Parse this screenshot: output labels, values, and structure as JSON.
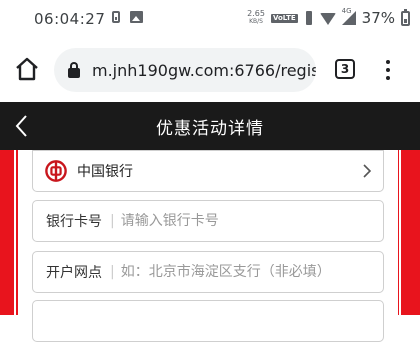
{
  "status_bar": {
    "time": "06:04:27",
    "net_speed_value": "2.65",
    "net_speed_unit": "KB/S",
    "volte": "VoLTE",
    "network": "4G",
    "battery": "37%"
  },
  "browser": {
    "url": "m.jnh190gw.com:6766/regis",
    "tab_count": "3"
  },
  "header": {
    "title": "优惠活动详情"
  },
  "form": {
    "bank": {
      "name": "中国银行",
      "logo_color": "#c8161d"
    },
    "card_number": {
      "label": "银行卡号",
      "placeholder": "请输入银行卡号"
    },
    "branch": {
      "label": "开户网点",
      "placeholder": "如：北京市海淀区支行（非必填）"
    }
  },
  "colors": {
    "accent_red": "#e8141d",
    "header_bg": "#1a1a1a"
  }
}
